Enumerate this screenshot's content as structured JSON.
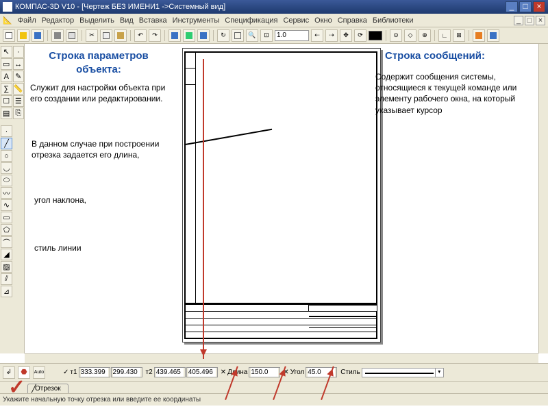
{
  "titlebar": {
    "text": "КОМПАС-3D V10 - [Чертеж БЕЗ ИМЕНИ1 ->Системный вид]"
  },
  "menu": [
    "Файл",
    "Редактор",
    "Выделить",
    "Вид",
    "Вставка",
    "Инструменты",
    "Спецификация",
    "Сервис",
    "Окно",
    "Справка",
    "Библиотеки"
  ],
  "toolbar": {
    "zoom": "1.0"
  },
  "parambar": {
    "t1_label": "т1",
    "t1x": "333.399",
    "t1y": "299.430",
    "t2_label": "т2",
    "t2x": "439.465",
    "t2y": "405.496",
    "len_label": "Длина",
    "len": "150.0",
    "ang_label": "Угол",
    "ang": "45.0",
    "style_label": "Стиль"
  },
  "tab": {
    "label": "Отрезок"
  },
  "status": {
    "text": "Укажите начальную точку отрезка или введите ее координаты"
  },
  "annotations": {
    "left_title": "Строка параметров объекта:",
    "left_p1": "Служит для настройки объекта при его создании или редактировании.",
    "left_p2": "В данном случае при построении отрезка задается его длина,",
    "left_p3": "угол наклона,",
    "left_p4": "стиль линии",
    "right_title": "Строка сообщений:",
    "right_p1": "Содержит сообщения системы, относящиеся к текущей команде или элементу рабочего окна, на который  указывает курсор"
  }
}
